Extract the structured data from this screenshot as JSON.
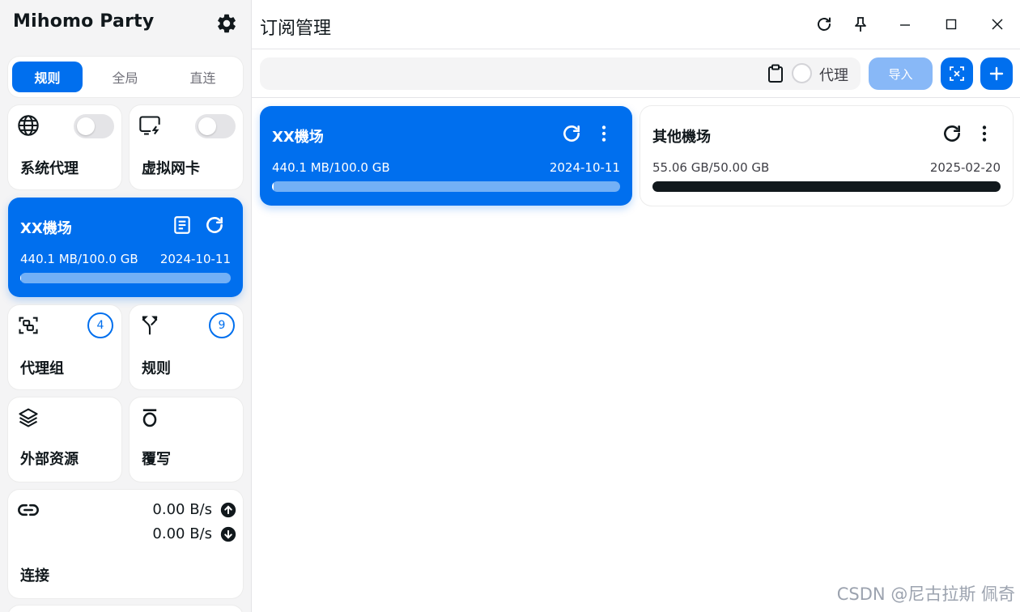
{
  "app": {
    "title": "Mihomo Party"
  },
  "icons": {
    "settings": "gear-icon",
    "globe": "globe-icon",
    "tun": "virtual-nic-icon",
    "profile_log": "document-icon",
    "refresh": "refresh-icon",
    "proxy_group": "proxy-group-icon",
    "rules": "fork-icon",
    "resources": "layers-icon",
    "override": "override-icon",
    "connections": "link-icon",
    "upload": "arrow-up-circle-icon",
    "download": "arrow-down-circle-icon",
    "pin": "pin-icon",
    "minimize": "minimize-icon",
    "maximize": "maximize-icon",
    "close": "close-icon",
    "clipboard": "clipboard-icon",
    "more": "more-vertical-icon",
    "qr": "scan-icon",
    "plus": "plus-icon"
  },
  "colors": {
    "accent": "#006fee",
    "import_disabled": "#88b8f7",
    "dark_bar": "#11181c"
  },
  "mode_tabs": [
    {
      "label": "规则",
      "active": true
    },
    {
      "label": "全局",
      "active": false
    },
    {
      "label": "直连",
      "active": false
    }
  ],
  "sidebar": {
    "system_proxy": {
      "label": "系统代理",
      "enabled": false
    },
    "tun": {
      "label": "虚拟网卡",
      "enabled": false
    },
    "current_profile": {
      "name": "XX機场",
      "usage": "440.1 MB/100.0 GB",
      "date": "2024-10-11",
      "used_fraction": 0.0044
    },
    "proxy_groups": {
      "label": "代理组",
      "count": "4"
    },
    "rules": {
      "label": "规则",
      "count": "9"
    },
    "resources": {
      "label": "外部资源"
    },
    "override": {
      "label": "覆写"
    },
    "connections": {
      "label": "连接",
      "upload": "0.00 B/s",
      "download": "0.00 B/s"
    }
  },
  "header": {
    "title": "订阅管理"
  },
  "toolbar": {
    "url_placeholder": "",
    "proxy_label": "代理",
    "import_label": "导入"
  },
  "profiles": [
    {
      "name": "XX機场",
      "usage": "440.1 MB/100.0 GB",
      "date": "2024-10-11",
      "used_fraction": 0.0044,
      "active": true
    },
    {
      "name": "其他機场",
      "usage": "55.06 GB/50.00 GB",
      "date": "2025-02-20",
      "used_fraction": 1.0,
      "active": false
    }
  ],
  "watermark": "CSDN @尼古拉斯 佩奇"
}
